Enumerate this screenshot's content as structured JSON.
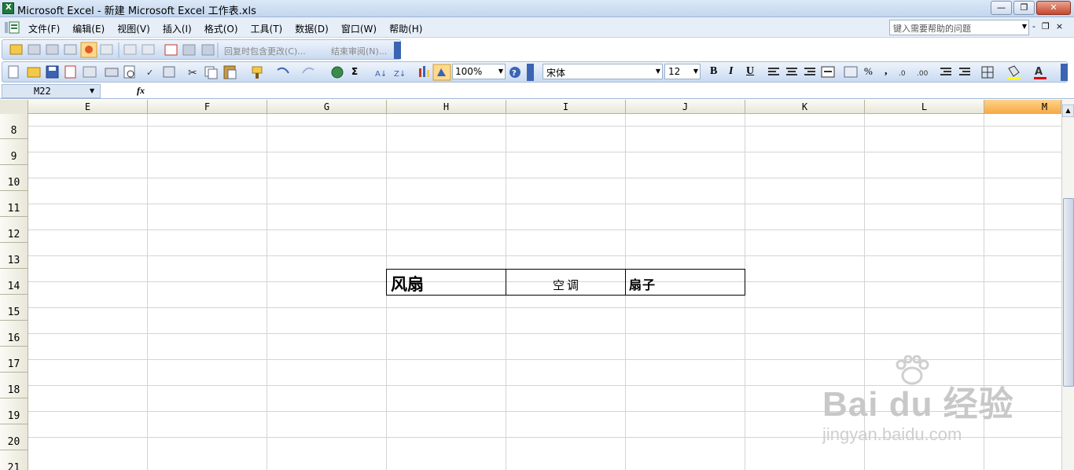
{
  "window": {
    "title": "Microsoft Excel - 新建 Microsoft Excel 工作表.xls",
    "buttons": {
      "minimize": "—",
      "restore": "❐",
      "close": "✕"
    }
  },
  "menu": {
    "items": [
      "文件(F)",
      "编辑(E)",
      "视图(V)",
      "插入(I)",
      "格式(O)",
      "工具(T)",
      "数据(D)",
      "窗口(W)",
      "帮助(H)"
    ],
    "help_placeholder": "键入需要帮助的问题",
    "doc_controls": [
      "-",
      "❐",
      "×"
    ]
  },
  "review_toolbar": {
    "reply_label": "回复时包含更改(C)...",
    "end_review_label": "结束审阅(N)..."
  },
  "standard_toolbar": {
    "zoom": "100%",
    "font_name": "宋体",
    "font_size": "12",
    "bold": "B",
    "italic": "I",
    "underline": "U",
    "percent": "%",
    "comma": ",",
    "sum": "Σ"
  },
  "formula_bar": {
    "name_box": "M22",
    "fx": "fx",
    "formula": ""
  },
  "sheet": {
    "columns": [
      "E",
      "F",
      "G",
      "H",
      "I",
      "J",
      "K",
      "L",
      "M"
    ],
    "selected_column": "M",
    "rows": [
      "8",
      "9",
      "10",
      "11",
      "12",
      "13",
      "14",
      "15",
      "16",
      "17",
      "18",
      "19",
      "20",
      "21"
    ],
    "cells": {
      "H14": "风扇",
      "I14": "空调",
      "J14": "扇子"
    }
  },
  "watermark": {
    "brand": "Bai du 经验",
    "url": "jingyan.baidu.com"
  }
}
